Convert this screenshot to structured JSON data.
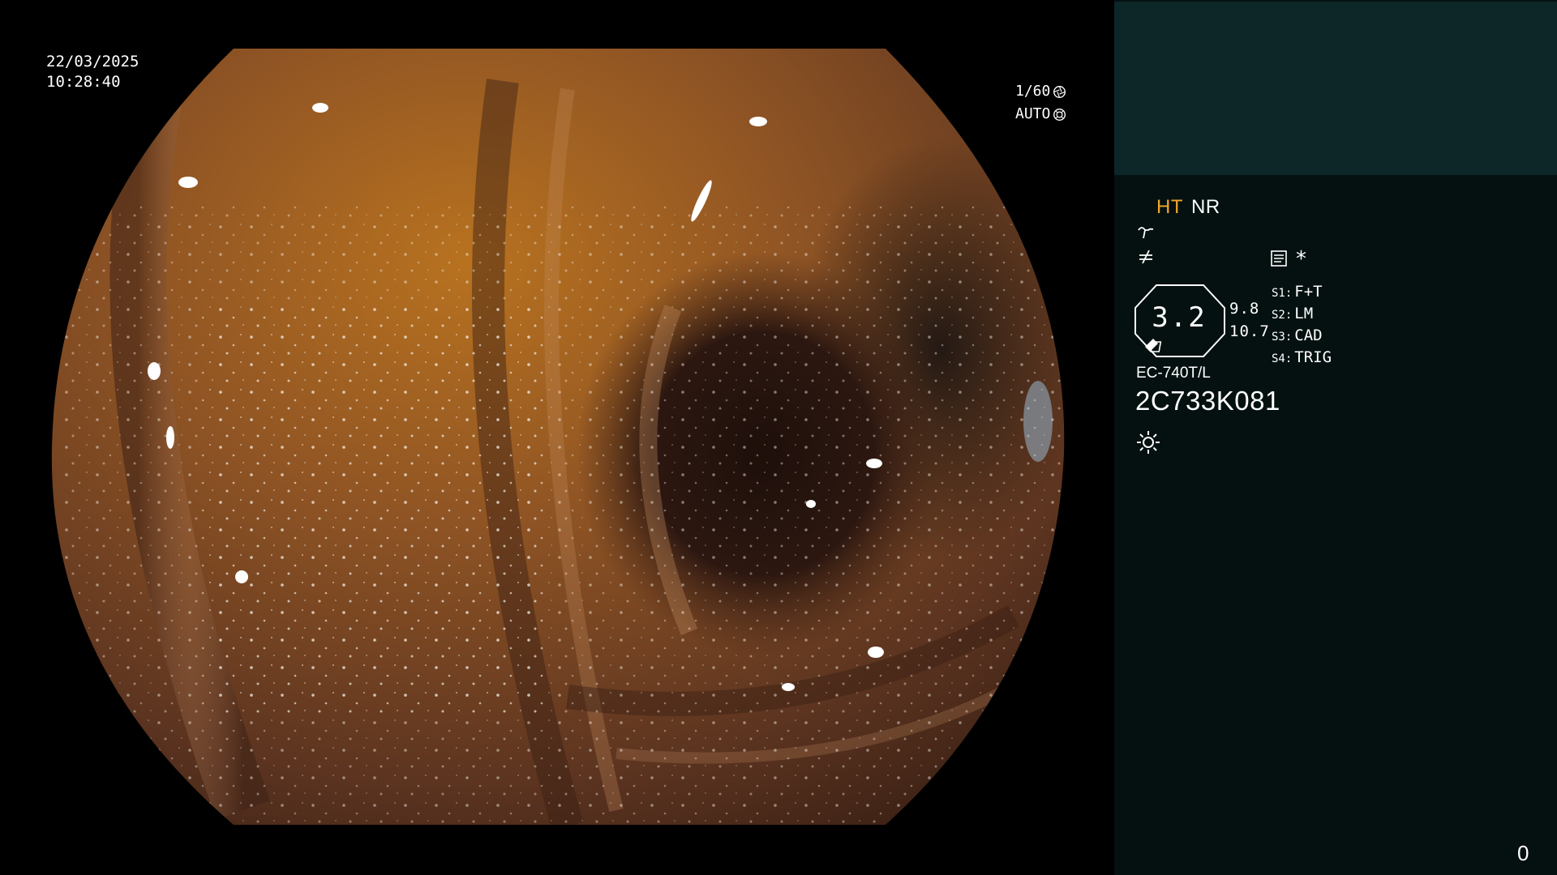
{
  "overlay": {
    "date": "22/03/2025",
    "time": "10:28:40",
    "shutter": "1/60",
    "shutter_icon": "shutter-icon",
    "iris": "AUTO",
    "iris_icon": "iris-icon"
  },
  "panel": {
    "mode_primary": "HT",
    "mode_secondary": "NR",
    "mode_primary_color": "#f2a52b",
    "icons": [
      "wave-icon",
      "not-equal-icon",
      "document-icon",
      "sun-icon"
    ],
    "asterisk": "*",
    "zoom_value": "3.2",
    "value_a": "9.8",
    "value_b": "10.7",
    "switches": [
      {
        "key": "S1:",
        "label": "F+T"
      },
      {
        "key": "S2:",
        "label": "LM"
      },
      {
        "key": "S3:",
        "label": "CAD"
      },
      {
        "key": "S4:",
        "label": "TRIG"
      }
    ],
    "scope_model": "EC-740T/L",
    "scope_serial": "2C733K081",
    "counter": "0",
    "panel_color": "#041110",
    "panel_top_color": "#0d2627"
  }
}
